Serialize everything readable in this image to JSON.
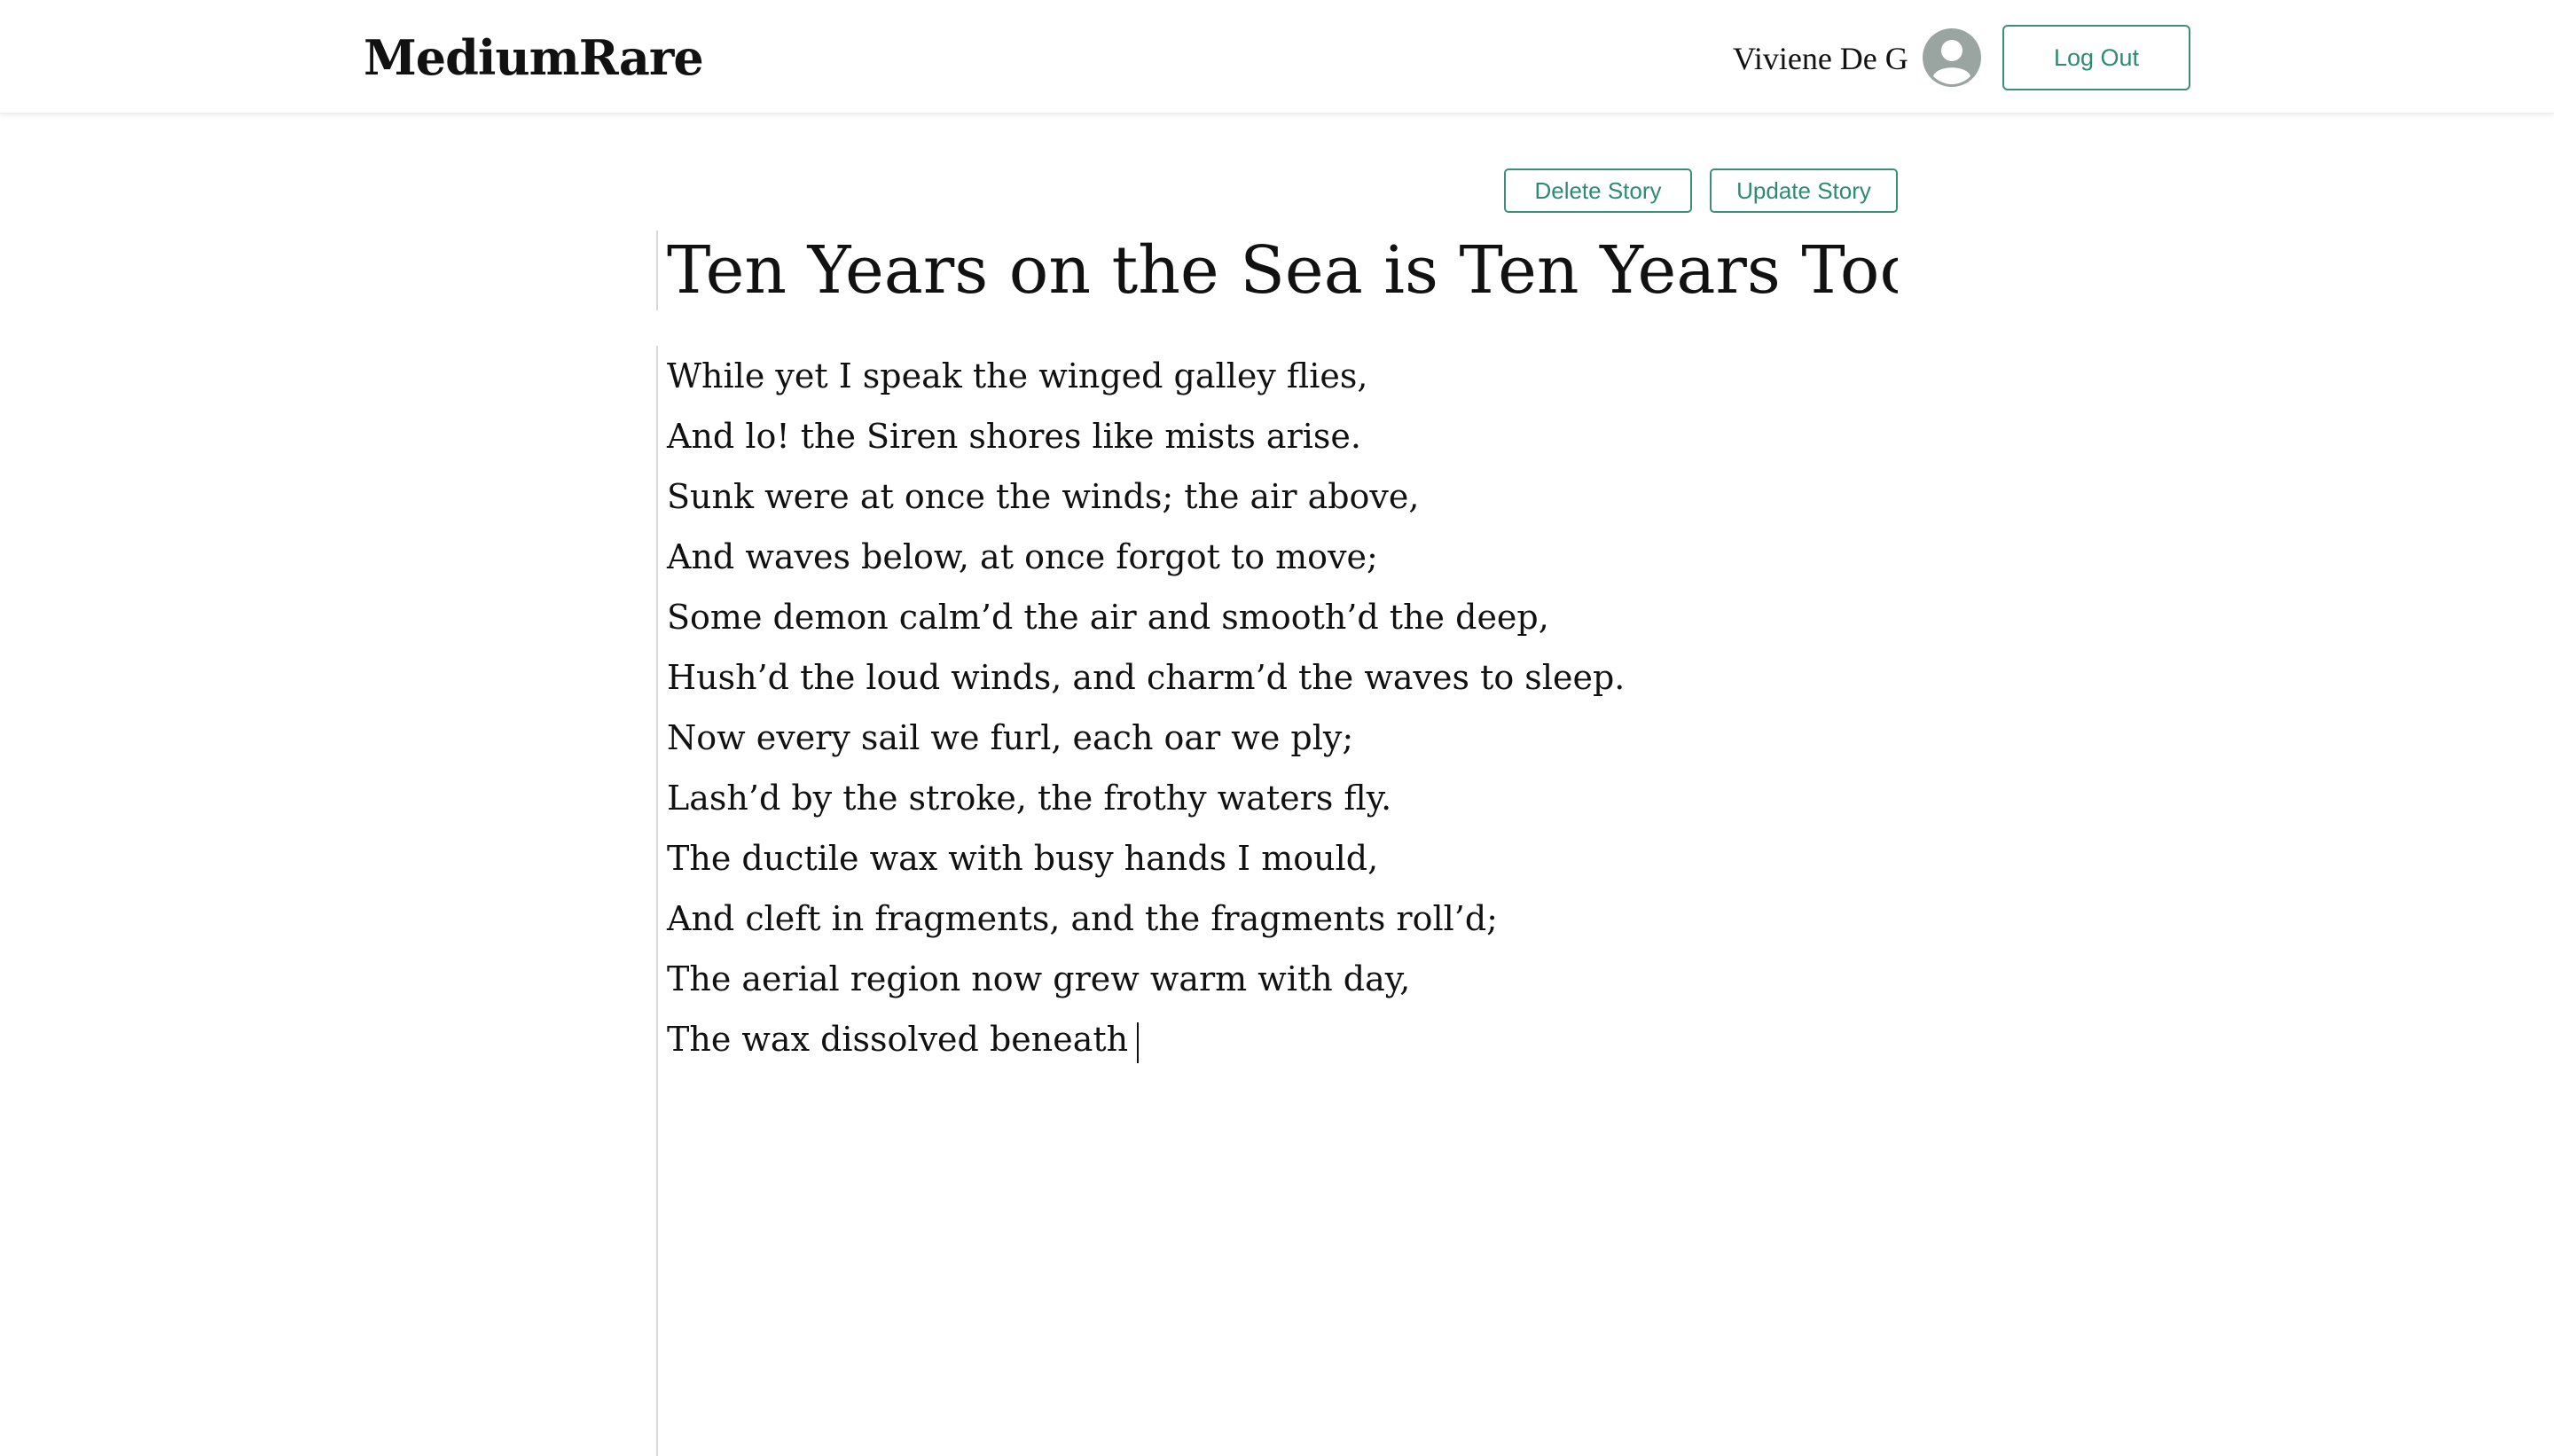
{
  "header": {
    "logo": "MediumRare",
    "user_name": "Viviene De G",
    "logout_label": "Log Out"
  },
  "actions": {
    "delete_label": "Delete Story",
    "update_label": "Update Story"
  },
  "story": {
    "title": "Ten Years on the Sea is Ten Years Too Long",
    "lines": [
      "While yet I speak the winged galley flies,",
      "And lo! the Siren shores like mists arise.",
      "Sunk were at once the winds; the air above,",
      "And waves below, at once forgot to move;",
      "Some demon calm’d the air and smooth’d the deep,",
      "Hush’d the loud winds, and charm’d the waves to sleep.",
      "Now every sail we furl, each oar we ply;",
      "Lash’d by the stroke, the frothy waters fly.",
      "The ductile wax with busy hands I mould,",
      "And cleft in fragments, and the fragments roll’d;",
      "The aerial region now grew warm with day,",
      "The wax dissolved beneath"
    ]
  },
  "icons": {
    "avatar": "user-circle-icon"
  },
  "colors": {
    "accent": "#2f8a72",
    "avatar": "#9aa5a1"
  }
}
